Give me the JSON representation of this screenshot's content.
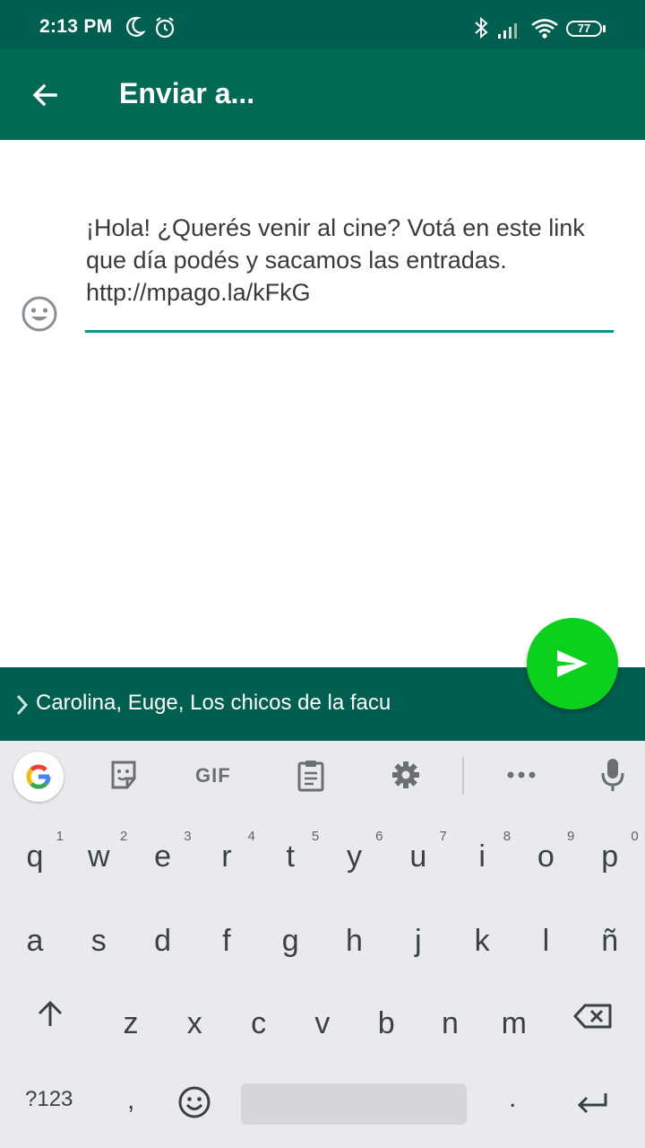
{
  "status_bar": {
    "time": "2:13 PM",
    "icons": [
      "moon-icon",
      "alarm-icon",
      "bluetooth-icon",
      "signal-icon",
      "wifi-icon"
    ],
    "battery": "77"
  },
  "app_bar": {
    "back_icon": "arrow-back-icon",
    "title": "Enviar a..."
  },
  "compose": {
    "message": "¡Hola! ¿Querés venir al cine? Votá en este link que día podés y sacamos las entradas. http://mpago.la/kFkG",
    "emoji_icon": "smiley-icon"
  },
  "recipients": {
    "chevron_icon": "chevron-right-icon",
    "text": "Carolina, Euge, Los chicos de la facu"
  },
  "send_button": {
    "icon": "send-icon"
  },
  "keyboard": {
    "toolbar": {
      "google_icon": "google-g-icon",
      "sticker_icon": "sticker-icon",
      "gif_label": "GIF",
      "clipboard_icon": "clipboard-icon",
      "settings_icon": "gear-icon",
      "more_icon": "more-horiz-icon",
      "mic_icon": "mic-icon"
    },
    "row1": [
      {
        "key": "q",
        "hint": "1"
      },
      {
        "key": "w",
        "hint": "2"
      },
      {
        "key": "e",
        "hint": "3"
      },
      {
        "key": "r",
        "hint": "4"
      },
      {
        "key": "t",
        "hint": "5"
      },
      {
        "key": "y",
        "hint": "6"
      },
      {
        "key": "u",
        "hint": "7"
      },
      {
        "key": "i",
        "hint": "8"
      },
      {
        "key": "o",
        "hint": "9"
      },
      {
        "key": "p",
        "hint": "0"
      }
    ],
    "row2": [
      "a",
      "s",
      "d",
      "f",
      "g",
      "h",
      "j",
      "k",
      "l",
      "ñ"
    ],
    "row3": [
      "z",
      "x",
      "c",
      "v",
      "b",
      "n",
      "m"
    ],
    "symbols_label": "?123",
    "comma": ",",
    "period": ".",
    "shift_icon": "shift-icon",
    "backspace_icon": "backspace-icon",
    "emoji_icon": "emoji-key-icon",
    "enter_icon": "enter-icon"
  }
}
